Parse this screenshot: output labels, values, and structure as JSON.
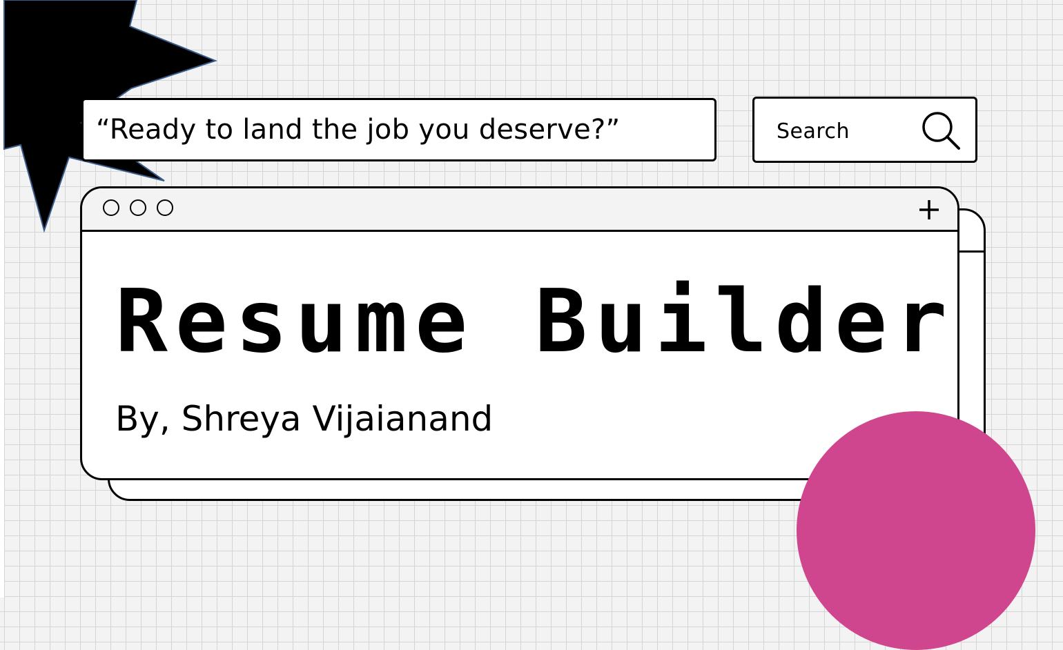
{
  "quote": {
    "text": "“Ready to land the job you deserve?”"
  },
  "search": {
    "label": "Search",
    "icon": "magnifier"
  },
  "window": {
    "title": "Resume Builder",
    "byline": "By, Shreya Vijaianand",
    "control_dots": [
      "dot",
      "dot",
      "dot"
    ],
    "new_tab_icon": "plus"
  },
  "colors": {
    "accent_circle": "#d0468e",
    "starburst": "#000000",
    "ink": "#000000",
    "panel": "#ffffff"
  }
}
